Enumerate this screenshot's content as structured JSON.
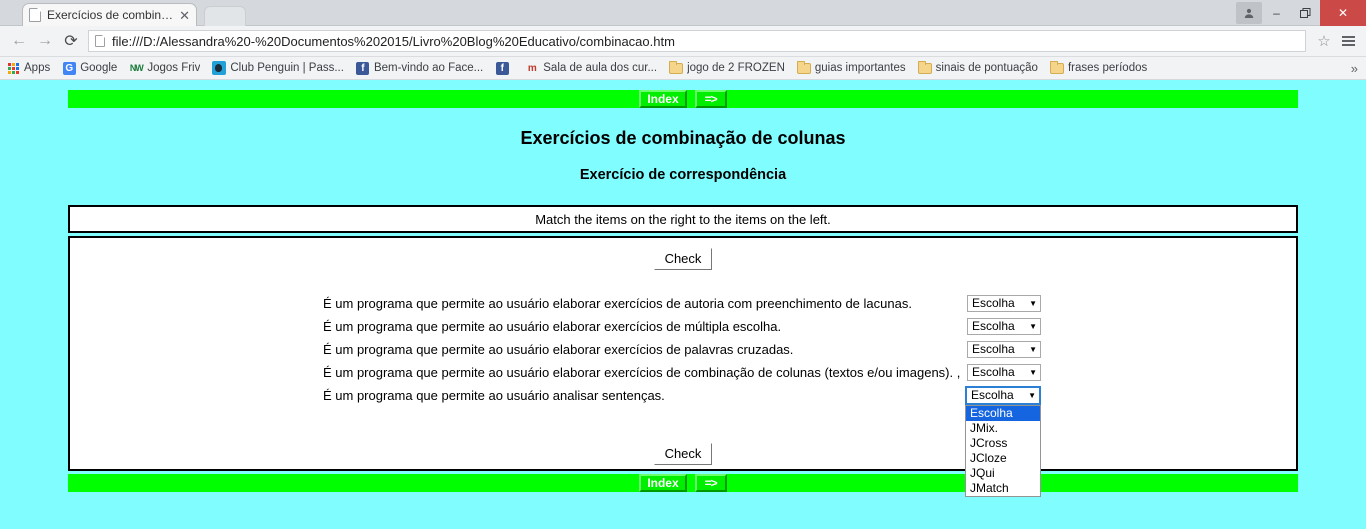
{
  "browser": {
    "tab": {
      "title": "Exercícios de combinação",
      "close_label": "✕",
      "favicon": "page-icon"
    },
    "url": "file:///D:/Alessandra%20-%20Documentos%202015/Livro%20Blog%20Educativo/combinacao.htm",
    "nav": {
      "back": "←",
      "forward": "→",
      "reload": "⟳"
    },
    "window_controls": {
      "profile": "person-icon",
      "minimize": "–",
      "maximize": "❐",
      "close": "✕"
    },
    "star": "☆",
    "menu": "hamburger-icon",
    "bookmarks": [
      {
        "label": "Apps",
        "icon": "apps-grid-icon"
      },
      {
        "label": "Google",
        "icon": "google-icon"
      },
      {
        "label": "Jogos Friv",
        "icon": "friv-icon"
      },
      {
        "label": "Club Penguin | Pass...",
        "icon": "penguin-icon"
      },
      {
        "label": "Bem-vindo ao Face...",
        "icon": "facebook-icon"
      },
      {
        "label": "",
        "icon": "facebook-icon"
      },
      {
        "label": "Sala de aula dos cur...",
        "icon": "moodle-icon"
      },
      {
        "label": "jogo de 2 FROZEN",
        "icon": "folder-icon"
      },
      {
        "label": "guias importantes",
        "icon": "folder-icon"
      },
      {
        "label": "sinais de pontuação",
        "icon": "folder-icon"
      },
      {
        "label": "frases períodos",
        "icon": "folder-icon"
      }
    ],
    "bookmarks_overflow": "»"
  },
  "page": {
    "colors": {
      "background": "#7ffdff",
      "navbar": "#00ff00",
      "button_text": "#ffffff"
    },
    "navbar": {
      "index_label": "Index",
      "next_label": "=>"
    },
    "title": "Exercícios de combinação de colunas",
    "subtitle": "Exercício de correspondência",
    "instruction": "Match the items on the right to the items on the left.",
    "check_label": "Check",
    "items": [
      {
        "text": "É um programa que permite ao usuário elaborar exercícios de autoria com preenchimento de lacunas.",
        "value": "Escolha"
      },
      {
        "text": "É um programa que permite ao usuário elaborar exercícios de múltipla escolha.",
        "value": "Escolha"
      },
      {
        "text": "É um programa que permite ao usuário elaborar exercícios de palavras cruzadas.",
        "value": "Escolha"
      },
      {
        "text": "É um programa que permite ao usuário elaborar exercícios de combinação de colunas (textos e/ou imagens). ,",
        "value": "Escolha"
      },
      {
        "text": "É um programa que permite ao usuário analisar sentenças.",
        "value": "Escolha"
      }
    ],
    "select_caret": "▼",
    "dropdown": {
      "open_for_item_index": 4,
      "options": [
        "Escolha",
        "JMix.",
        "JCross",
        "JCloze",
        "JQui",
        "JMatch"
      ],
      "selected": "Escolha"
    }
  }
}
